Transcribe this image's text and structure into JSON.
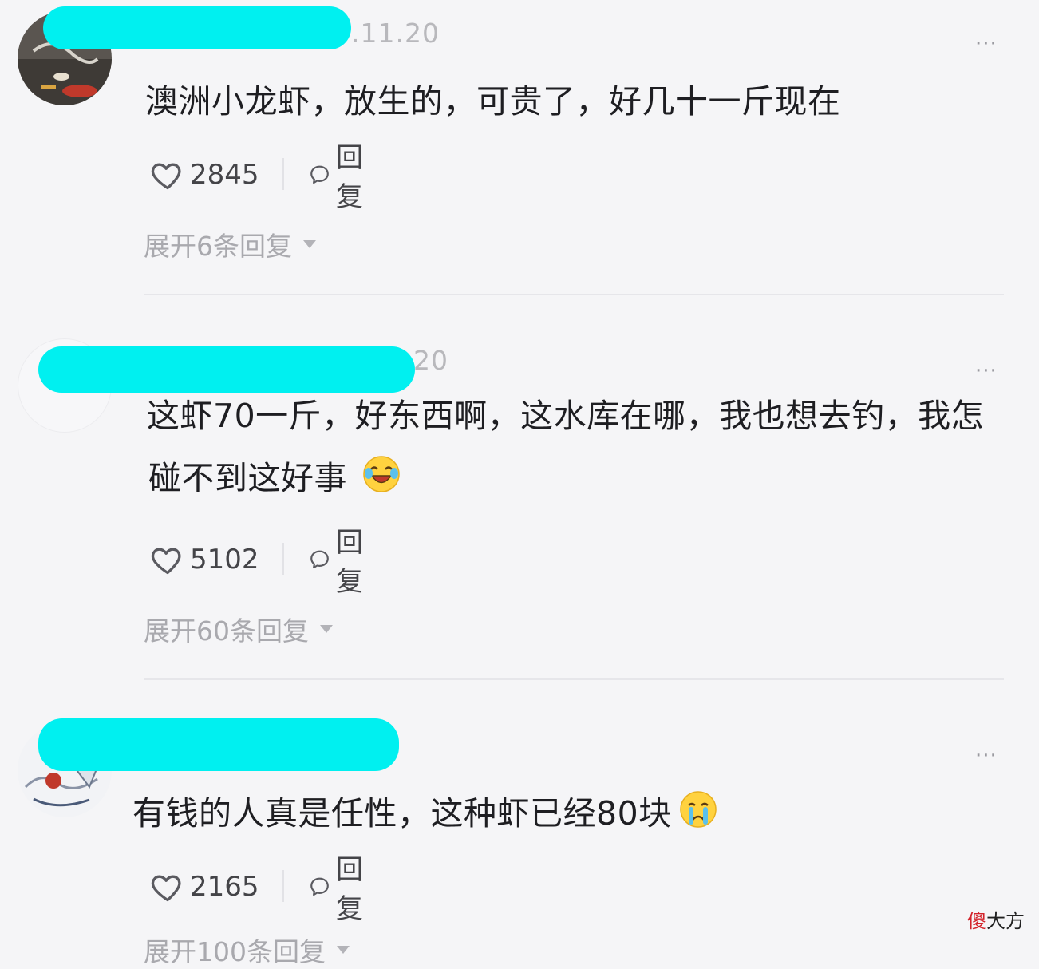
{
  "comments": [
    {
      "date_partial": ".11.20",
      "content": "澳洲小龙虾，放生的，可贵了，好几十一斤现在",
      "content_line2": "",
      "likes": "2845",
      "reply_label": "回复",
      "expand_label": "展开6条回复",
      "emoji": ""
    },
    {
      "date_partial": "20",
      "content": "这虾70一斤，好东西啊，这水库在哪，我也想去钓，我怎",
      "content_line2": "碰不到这好事",
      "likes": "5102",
      "reply_label": "回复",
      "expand_label": "展开60条回复",
      "emoji": "laughing-crying-emoji"
    },
    {
      "date_partial": "",
      "content": "有钱的人真是任性，这种虾已经80块",
      "content_line2": "",
      "likes": "2165",
      "reply_label": "回复",
      "expand_label": "展开100条回复",
      "emoji": "crying-emoji"
    }
  ],
  "more_glyph": "···",
  "watermark": {
    "red": "傻",
    "black": "大方"
  },
  "colors": {
    "background": "#f5f5f7",
    "redaction": "#00f0f0",
    "text": "#1e1e22",
    "muted": "#a9a9ae",
    "watermark_red": "#d3232b"
  }
}
